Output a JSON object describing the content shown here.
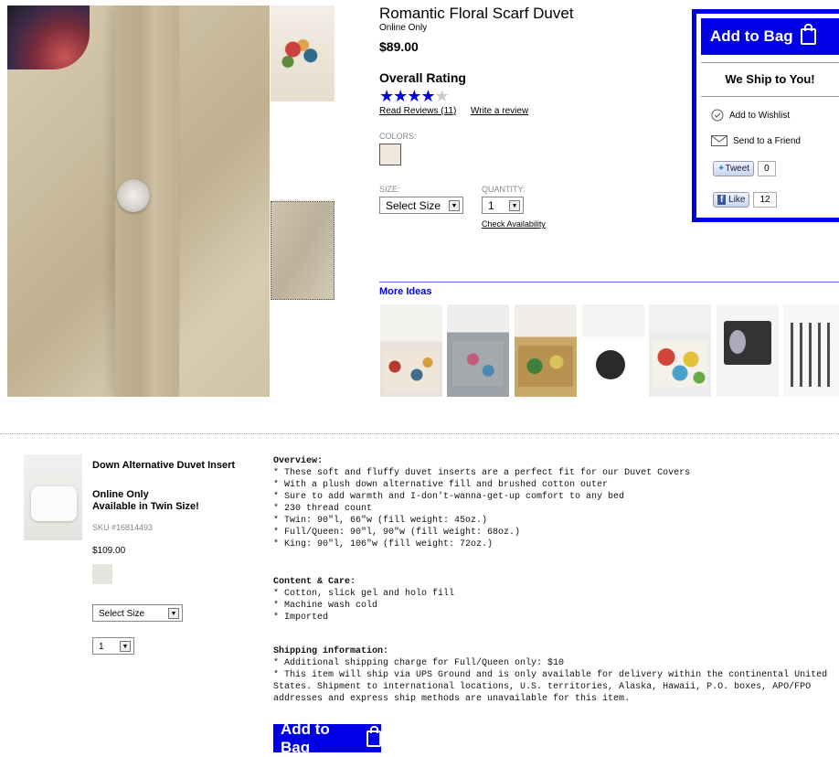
{
  "product": {
    "title": "Romantic Floral Scarf Duvet",
    "online": "Online Only",
    "price": "$89.00",
    "rating_heading": "Overall Rating",
    "stars_on": "★★★★",
    "stars_off": "★",
    "rating_value": 4,
    "rating_max": 5,
    "read_reviews": "Read Reviews (11)",
    "write_review": "Write a review",
    "colors_label": "COLORS:",
    "color_swatch": "#f1e6dc",
    "size_label": "SIZE:",
    "size_value": "Select Size",
    "quantity_label": "QUANTITY:",
    "quantity_value": "1",
    "check_availability": "Check Availability"
  },
  "sidebar": {
    "add_to_bag": "Add to Bag",
    "ship_to_you": "We Ship to You!",
    "wishlist": "Add to Wishlist",
    "send_friend": "Send to a Friend",
    "tweet": "Tweet",
    "tweet_count": "0",
    "like": "Like",
    "like_count": "12"
  },
  "more_ideas": {
    "label": "More Ideas",
    "items": [
      {
        "name": "floral-duvet-idea"
      },
      {
        "name": "gray-floral-duvet-idea"
      },
      {
        "name": "garden-duvet-idea"
      },
      {
        "name": "deer-print-duvet-idea"
      },
      {
        "name": "colorful-floral-duvet-idea"
      },
      {
        "name": "mirror-organizer-idea"
      },
      {
        "name": "hook-rack-idea"
      }
    ]
  },
  "lower_product": {
    "title": "Down Alternative Duvet Insert",
    "online": "Online Only",
    "availability": "Available in Twin Size!",
    "sku": "SKU #16814493",
    "price": "$109.00",
    "swatch_color": "#e6e4df",
    "size_value": "Select Size",
    "qty_value": "1"
  },
  "description": {
    "overview_heading": "Overview:",
    "overview": [
      "* These soft and fluffy duvet inserts are a perfect fit for our Duvet Covers",
      "* With a plush down alternative fill and brushed cotton outer",
      "* Sure to add warmth and I-don't-wanna-get-up comfort to any bed",
      "* 230 thread count",
      "* Twin: 90\"l, 66\"w (fill weight: 45oz.)",
      "* Full/Queen: 90\"l, 90\"w (fill weight: 68oz.)",
      "* King: 90\"l, 106\"w (fill weight: 72oz.)"
    ],
    "care_heading": "Content & Care:",
    "care": [
      "* Cotton, slick gel and holo fill",
      "* Machine wash cold",
      "* Imported"
    ],
    "shipping_heading": "Shipping information:",
    "shipping": [
      "* Additional shipping charge for Full/Queen only: $10",
      "* This item will ship via UPS Ground and is only available for delivery within the continental United",
      "States. Shipment to international locations, U.S. territories, Alaska, Hawaii, P.O. boxes, APO/FPO",
      "addresses and express ship methods are unavailable for this item."
    ],
    "add_to_bag": "Add to Bag"
  },
  "colors": {
    "accent": "#0000e6",
    "muted_text": "#888888"
  }
}
